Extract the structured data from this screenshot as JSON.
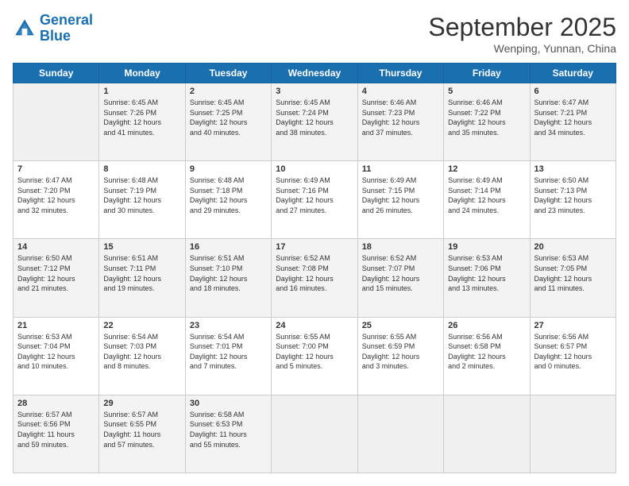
{
  "header": {
    "logo_line1": "General",
    "logo_line2": "Blue",
    "month": "September 2025",
    "location": "Wenping, Yunnan, China"
  },
  "days_of_week": [
    "Sunday",
    "Monday",
    "Tuesday",
    "Wednesday",
    "Thursday",
    "Friday",
    "Saturday"
  ],
  "weeks": [
    [
      {
        "num": "",
        "info": ""
      },
      {
        "num": "1",
        "info": "Sunrise: 6:45 AM\nSunset: 7:26 PM\nDaylight: 12 hours\nand 41 minutes."
      },
      {
        "num": "2",
        "info": "Sunrise: 6:45 AM\nSunset: 7:25 PM\nDaylight: 12 hours\nand 40 minutes."
      },
      {
        "num": "3",
        "info": "Sunrise: 6:45 AM\nSunset: 7:24 PM\nDaylight: 12 hours\nand 38 minutes."
      },
      {
        "num": "4",
        "info": "Sunrise: 6:46 AM\nSunset: 7:23 PM\nDaylight: 12 hours\nand 37 minutes."
      },
      {
        "num": "5",
        "info": "Sunrise: 6:46 AM\nSunset: 7:22 PM\nDaylight: 12 hours\nand 35 minutes."
      },
      {
        "num": "6",
        "info": "Sunrise: 6:47 AM\nSunset: 7:21 PM\nDaylight: 12 hours\nand 34 minutes."
      }
    ],
    [
      {
        "num": "7",
        "info": "Sunrise: 6:47 AM\nSunset: 7:20 PM\nDaylight: 12 hours\nand 32 minutes."
      },
      {
        "num": "8",
        "info": "Sunrise: 6:48 AM\nSunset: 7:19 PM\nDaylight: 12 hours\nand 30 minutes."
      },
      {
        "num": "9",
        "info": "Sunrise: 6:48 AM\nSunset: 7:18 PM\nDaylight: 12 hours\nand 29 minutes."
      },
      {
        "num": "10",
        "info": "Sunrise: 6:49 AM\nSunset: 7:16 PM\nDaylight: 12 hours\nand 27 minutes."
      },
      {
        "num": "11",
        "info": "Sunrise: 6:49 AM\nSunset: 7:15 PM\nDaylight: 12 hours\nand 26 minutes."
      },
      {
        "num": "12",
        "info": "Sunrise: 6:49 AM\nSunset: 7:14 PM\nDaylight: 12 hours\nand 24 minutes."
      },
      {
        "num": "13",
        "info": "Sunrise: 6:50 AM\nSunset: 7:13 PM\nDaylight: 12 hours\nand 23 minutes."
      }
    ],
    [
      {
        "num": "14",
        "info": "Sunrise: 6:50 AM\nSunset: 7:12 PM\nDaylight: 12 hours\nand 21 minutes."
      },
      {
        "num": "15",
        "info": "Sunrise: 6:51 AM\nSunset: 7:11 PM\nDaylight: 12 hours\nand 19 minutes."
      },
      {
        "num": "16",
        "info": "Sunrise: 6:51 AM\nSunset: 7:10 PM\nDaylight: 12 hours\nand 18 minutes."
      },
      {
        "num": "17",
        "info": "Sunrise: 6:52 AM\nSunset: 7:08 PM\nDaylight: 12 hours\nand 16 minutes."
      },
      {
        "num": "18",
        "info": "Sunrise: 6:52 AM\nSunset: 7:07 PM\nDaylight: 12 hours\nand 15 minutes."
      },
      {
        "num": "19",
        "info": "Sunrise: 6:53 AM\nSunset: 7:06 PM\nDaylight: 12 hours\nand 13 minutes."
      },
      {
        "num": "20",
        "info": "Sunrise: 6:53 AM\nSunset: 7:05 PM\nDaylight: 12 hours\nand 11 minutes."
      }
    ],
    [
      {
        "num": "21",
        "info": "Sunrise: 6:53 AM\nSunset: 7:04 PM\nDaylight: 12 hours\nand 10 minutes."
      },
      {
        "num": "22",
        "info": "Sunrise: 6:54 AM\nSunset: 7:03 PM\nDaylight: 12 hours\nand 8 minutes."
      },
      {
        "num": "23",
        "info": "Sunrise: 6:54 AM\nSunset: 7:01 PM\nDaylight: 12 hours\nand 7 minutes."
      },
      {
        "num": "24",
        "info": "Sunrise: 6:55 AM\nSunset: 7:00 PM\nDaylight: 12 hours\nand 5 minutes."
      },
      {
        "num": "25",
        "info": "Sunrise: 6:55 AM\nSunset: 6:59 PM\nDaylight: 12 hours\nand 3 minutes."
      },
      {
        "num": "26",
        "info": "Sunrise: 6:56 AM\nSunset: 6:58 PM\nDaylight: 12 hours\nand 2 minutes."
      },
      {
        "num": "27",
        "info": "Sunrise: 6:56 AM\nSunset: 6:57 PM\nDaylight: 12 hours\nand 0 minutes."
      }
    ],
    [
      {
        "num": "28",
        "info": "Sunrise: 6:57 AM\nSunset: 6:56 PM\nDaylight: 11 hours\nand 59 minutes."
      },
      {
        "num": "29",
        "info": "Sunrise: 6:57 AM\nSunset: 6:55 PM\nDaylight: 11 hours\nand 57 minutes."
      },
      {
        "num": "30",
        "info": "Sunrise: 6:58 AM\nSunset: 6:53 PM\nDaylight: 11 hours\nand 55 minutes."
      },
      {
        "num": "",
        "info": ""
      },
      {
        "num": "",
        "info": ""
      },
      {
        "num": "",
        "info": ""
      },
      {
        "num": "",
        "info": ""
      }
    ]
  ]
}
